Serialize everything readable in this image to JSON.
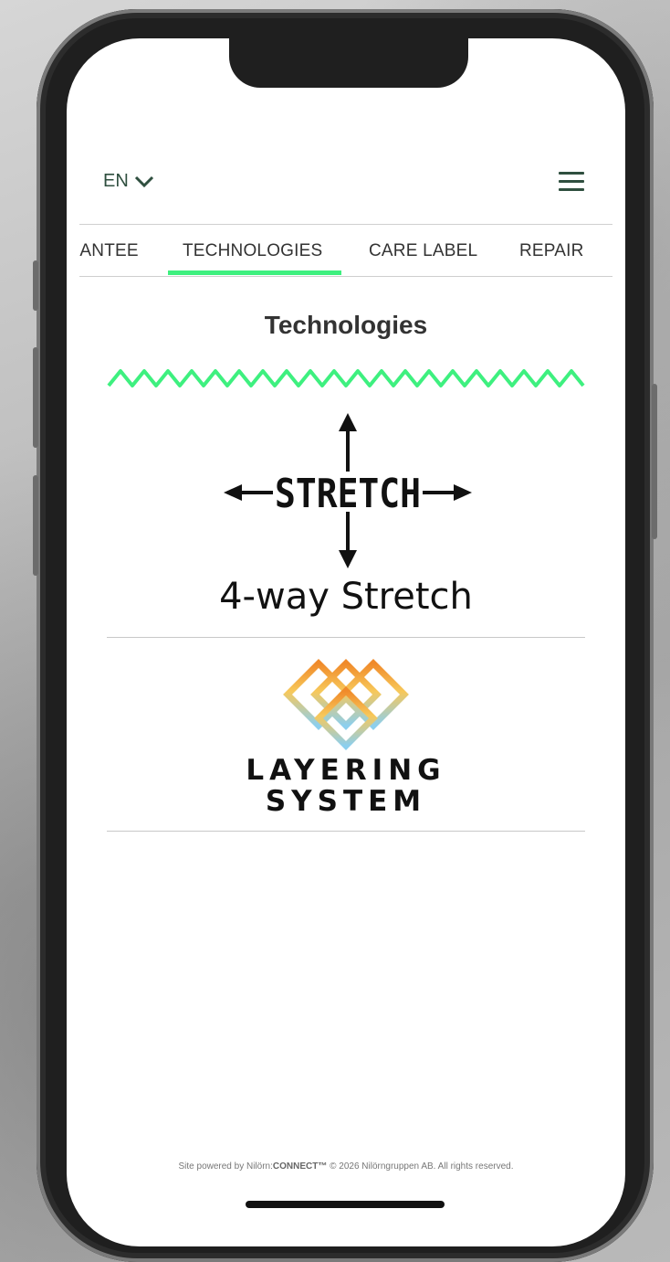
{
  "header": {
    "language": "EN"
  },
  "tabs": [
    {
      "label": "GUARANTEE",
      "visible_label": "’ANTEE"
    },
    {
      "label": "TECHNOLOGIES",
      "active": true
    },
    {
      "label": "CARE LABEL"
    },
    {
      "label": "REPAIR"
    }
  ],
  "page": {
    "title": "Technologies"
  },
  "technologies": [
    {
      "logo_word": "STRETCH",
      "label": "4-way Stretch"
    },
    {
      "logo_line1": "LAYERING",
      "logo_line2": "SYSTEM"
    }
  ],
  "footer": {
    "prefix": "Site powered by Nilörn:",
    "brand": "CONNECT™",
    "suffix": " © 2026 Nilörngruppen AB. All rights reserved."
  },
  "colors": {
    "accent": "#3ef07f",
    "text_dark": "#2f4f3f"
  },
  "icons": {
    "language": "chevron-down-icon",
    "menu": "hamburger-menu-icon"
  }
}
